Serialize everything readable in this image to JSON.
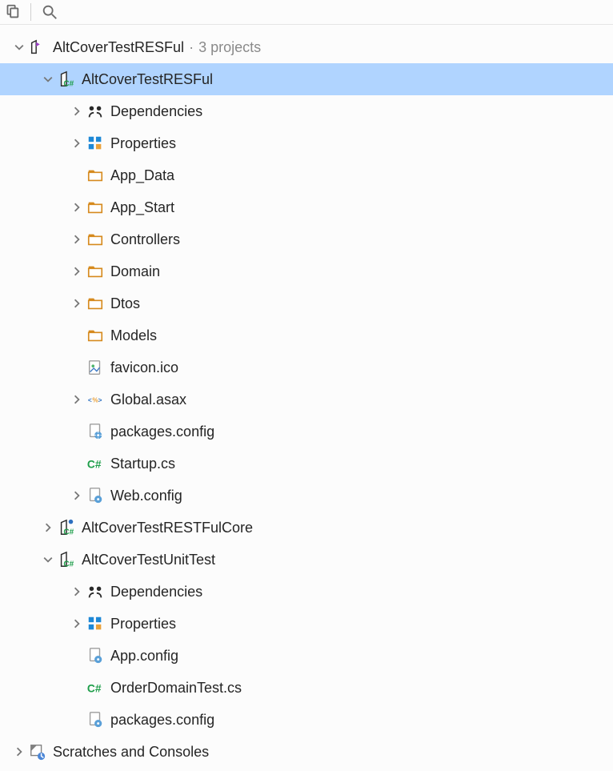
{
  "toolbar": {
    "copy_icon": "copy-reference",
    "search_icon": "search"
  },
  "solution": {
    "name": "AltCoverTestRESFul",
    "suffix": "3 projects"
  },
  "projects": [
    {
      "name": "AltCoverTestRESFul",
      "expanded": true,
      "selected": true,
      "items": [
        {
          "label": "Dependencies",
          "icon": "deps",
          "chevron": true
        },
        {
          "label": "Properties",
          "icon": "props",
          "chevron": true
        },
        {
          "label": "App_Data",
          "icon": "folder",
          "chevron": false
        },
        {
          "label": "App_Start",
          "icon": "folder",
          "chevron": true
        },
        {
          "label": "Controllers",
          "icon": "folder",
          "chevron": true
        },
        {
          "label": "Domain",
          "icon": "folder",
          "chevron": true
        },
        {
          "label": "Dtos",
          "icon": "folder",
          "chevron": true
        },
        {
          "label": "Models",
          "icon": "folder",
          "chevron": false
        },
        {
          "label": "favicon.ico",
          "icon": "image",
          "chevron": false
        },
        {
          "label": "Global.asax",
          "icon": "asax",
          "chevron": true
        },
        {
          "label": "packages.config",
          "icon": "config",
          "chevron": false
        },
        {
          "label": "Startup.cs",
          "icon": "cs",
          "chevron": false
        },
        {
          "label": "Web.config",
          "icon": "config",
          "chevron": true
        }
      ]
    },
    {
      "name": "AltCoverTestRESTFulCore",
      "expanded": false,
      "selected": false,
      "badge": "dot"
    },
    {
      "name": "AltCoverTestUnitTest",
      "expanded": true,
      "selected": false,
      "items": [
        {
          "label": "Dependencies",
          "icon": "deps",
          "chevron": true
        },
        {
          "label": "Properties",
          "icon": "props",
          "chevron": true
        },
        {
          "label": "App.config",
          "icon": "config",
          "chevron": false
        },
        {
          "label": "OrderDomainTest.cs",
          "icon": "cs",
          "chevron": false
        },
        {
          "label": "packages.config",
          "icon": "config",
          "chevron": false
        }
      ]
    }
  ],
  "scratches": {
    "label": "Scratches and Consoles"
  }
}
